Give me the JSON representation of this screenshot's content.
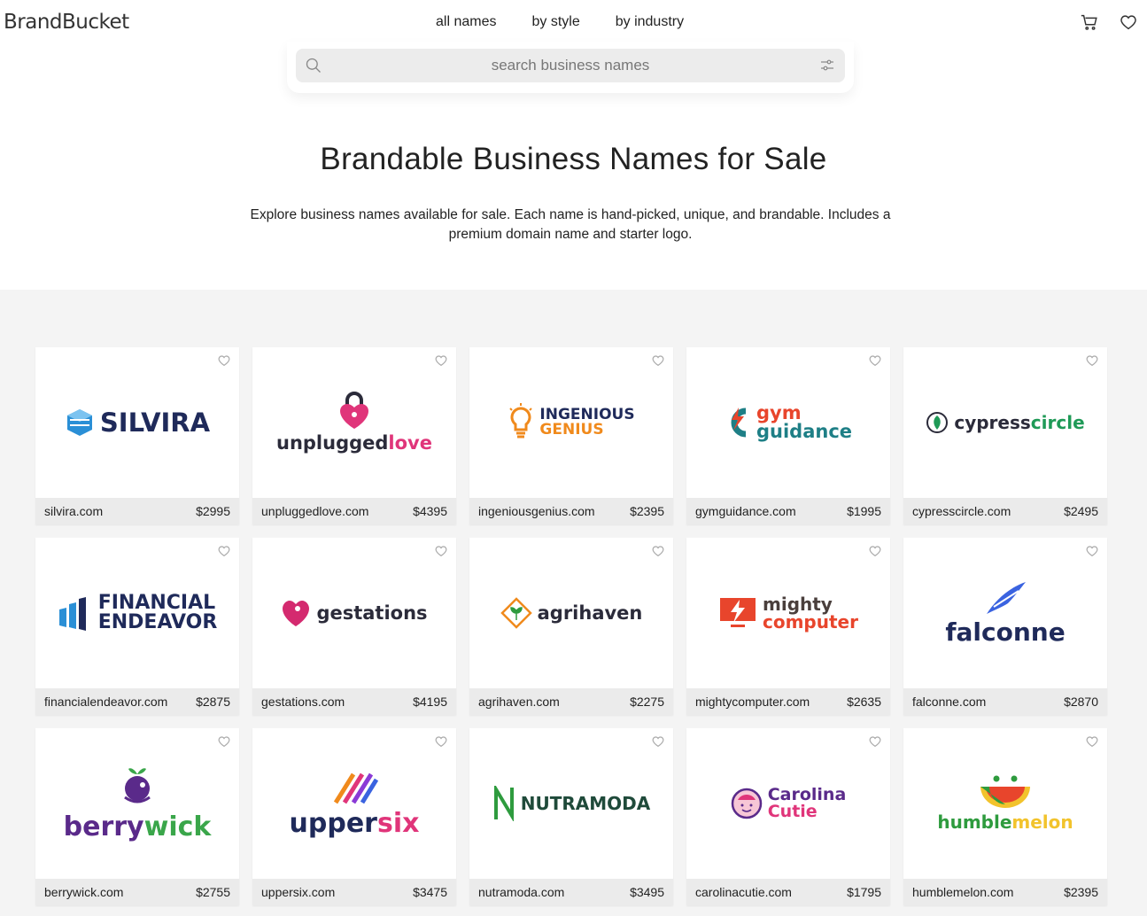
{
  "header": {
    "logo": "BrandBucket",
    "nav": [
      "all names",
      "by style",
      "by industry"
    ]
  },
  "search": {
    "placeholder": "search business names"
  },
  "hero": {
    "title": "Brandable Business Names for Sale",
    "description": "Explore business names available for sale. Each name is hand-picked, unique, and brandable. Includes a premium domain name and starter logo."
  },
  "cards": [
    {
      "domain": "silvira.com",
      "price": "$2995",
      "logo_text": "SILVIRA",
      "color": "#1f2a5a",
      "accent": "#2a8fd6",
      "icon": "cube-icon"
    },
    {
      "domain": "unpluggedlove.com",
      "price": "$4395",
      "logo_text": "unplugged",
      "logo_text2": "love",
      "color": "#2b2b3a",
      "accent": "#e0357a",
      "icon": "heart-lock-icon"
    },
    {
      "domain": "ingeniousgenius.com",
      "price": "$2395",
      "logo_text": "INGENIOUS",
      "logo_text2": "GENIUS",
      "color": "#1f2a5a",
      "accent": "#f08a1c",
      "icon": "lightbulb-icon"
    },
    {
      "domain": "gymguidance.com",
      "price": "$1995",
      "logo_text": "gym",
      "logo_text2": "guidance",
      "color": "#1e7f86",
      "accent": "#e8452c",
      "icon": "g-bolt-icon"
    },
    {
      "domain": "cypresscircle.com",
      "price": "$2495",
      "logo_text": "cypress",
      "logo_text2": "circle",
      "color": "#2b2b3a",
      "accent": "#1f9a57",
      "icon": "leaf-circle-icon"
    },
    {
      "domain": "financialendeavor.com",
      "price": "$2875",
      "logo_text": "FINANCIAL",
      "logo_text2": "ENDEAVOR",
      "color": "#1f2a5a",
      "accent": "#2a8fd6",
      "icon": "bars-icon"
    },
    {
      "domain": "gestations.com",
      "price": "$4195",
      "logo_text": "gestations",
      "color": "#2b2b3a",
      "accent": "#d42a6f",
      "icon": "heart-figure-icon"
    },
    {
      "domain": "agrihaven.com",
      "price": "$2275",
      "logo_text": "agrihaven",
      "color": "#2b2b3a",
      "accent": "#2e9b3e",
      "icon": "sprout-diamond-icon"
    },
    {
      "domain": "mightycomputer.com",
      "price": "$2635",
      "logo_text": "mighty",
      "logo_text2": "computer",
      "color": "#4a3f3c",
      "accent": "#e8452c",
      "icon": "monitor-bolt-icon"
    },
    {
      "domain": "falconne.com",
      "price": "$2870",
      "logo_text": "falconne",
      "color": "#1f2a5a",
      "accent": "#3a63e0",
      "icon": "wing-icon"
    },
    {
      "domain": "berrywick.com",
      "price": "$2755",
      "logo_text": "berry",
      "logo_text2": "wick",
      "color": "#5a2a8a",
      "accent": "#3aa64a",
      "icon": "berry-icon"
    },
    {
      "domain": "uppersix.com",
      "price": "$3475",
      "logo_text": "upper",
      "logo_text2": "six",
      "color": "#1f2a5a",
      "accent": "#e0357a",
      "icon": "stripes-icon"
    },
    {
      "domain": "nutramoda.com",
      "price": "$3495",
      "logo_text": "NUTRAMODA",
      "color": "#1f4a3a",
      "accent": "#2e9b3e",
      "icon": "n-leaf-icon"
    },
    {
      "domain": "carolinacutie.com",
      "price": "$1795",
      "logo_text": "Carolina",
      "logo_text2": "Cutie",
      "color": "#5a2a8a",
      "accent": "#e0357a",
      "icon": "face-icon"
    },
    {
      "domain": "humblemelon.com",
      "price": "$2395",
      "logo_text": "humble",
      "logo_text2": "melon",
      "color": "#2e9b3e",
      "accent": "#f2c32c",
      "icon": "melon-icon"
    }
  ]
}
